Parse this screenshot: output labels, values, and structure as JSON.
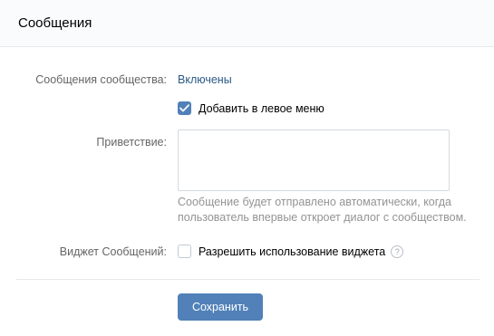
{
  "header": {
    "title": "Сообщения"
  },
  "community_messages": {
    "label": "Сообщения сообщества:",
    "value": "Включены"
  },
  "left_menu": {
    "label": "Добавить в левое меню",
    "checked": true
  },
  "greeting": {
    "label": "Приветствие:",
    "value": "",
    "placeholder": "",
    "hint": "Сообщение будет отправлено автоматически, когда пользователь впервые откроет диалог с сообществом."
  },
  "widget": {
    "label": "Виджет Сообщений:",
    "checkbox_label": "Разрешить использование виджета",
    "checked": false,
    "help_icon": "question-circle-icon"
  },
  "actions": {
    "save_label": "Сохранить"
  },
  "colors": {
    "accent": "#5181b8",
    "link": "#2a5885",
    "label": "#656565",
    "hint": "#939393",
    "divider": "#e7e8ec",
    "header_bg": "#fafbfc"
  }
}
